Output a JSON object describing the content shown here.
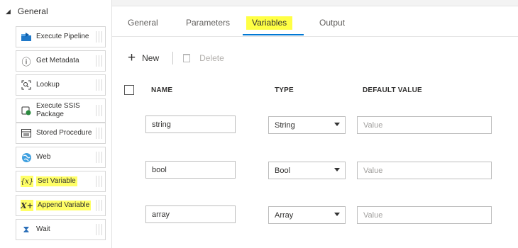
{
  "sidebar": {
    "group_label": "General",
    "items": [
      {
        "label": "Execute Pipeline",
        "icon": "execute-pipeline-icon"
      },
      {
        "label": "Get Metadata",
        "icon": "info-icon"
      },
      {
        "label": "Lookup",
        "icon": "lookup-icon"
      },
      {
        "label": "Execute SSIS Package",
        "icon": "ssis-icon"
      },
      {
        "label": "Stored Procedure",
        "icon": "stored-procedure-icon"
      },
      {
        "label": "Web",
        "icon": "globe-icon"
      },
      {
        "label": "Set Variable",
        "icon": "set-variable-icon"
      },
      {
        "label": "Append Variable",
        "icon": "append-variable-icon"
      },
      {
        "label": "Wait",
        "icon": "hourglass-icon"
      }
    ],
    "icon_glyphs": {
      "info": "ⓘ",
      "hourglass": "⧗",
      "set_variable": "{x}",
      "append_variable": "X+"
    }
  },
  "tabs": [
    {
      "label": "General"
    },
    {
      "label": "Parameters"
    },
    {
      "label": "Variables"
    },
    {
      "label": "Output"
    }
  ],
  "active_tab": "Variables",
  "toolbar": {
    "new_label": "New",
    "plus_glyph": "+",
    "delete_label": "Delete"
  },
  "table": {
    "columns": [
      "NAME",
      "TYPE",
      "DEFAULT VALUE"
    ],
    "rows": [
      {
        "name": "string",
        "type": "String",
        "default_placeholder": "Value"
      },
      {
        "name": "bool",
        "type": "Bool",
        "default_placeholder": "Value"
      },
      {
        "name": "array",
        "type": "Array",
        "default_placeholder": "Value"
      }
    ]
  },
  "colors": {
    "highlight": "#ffff44",
    "accent": "#0078d4",
    "border": "#bdbdbd"
  }
}
